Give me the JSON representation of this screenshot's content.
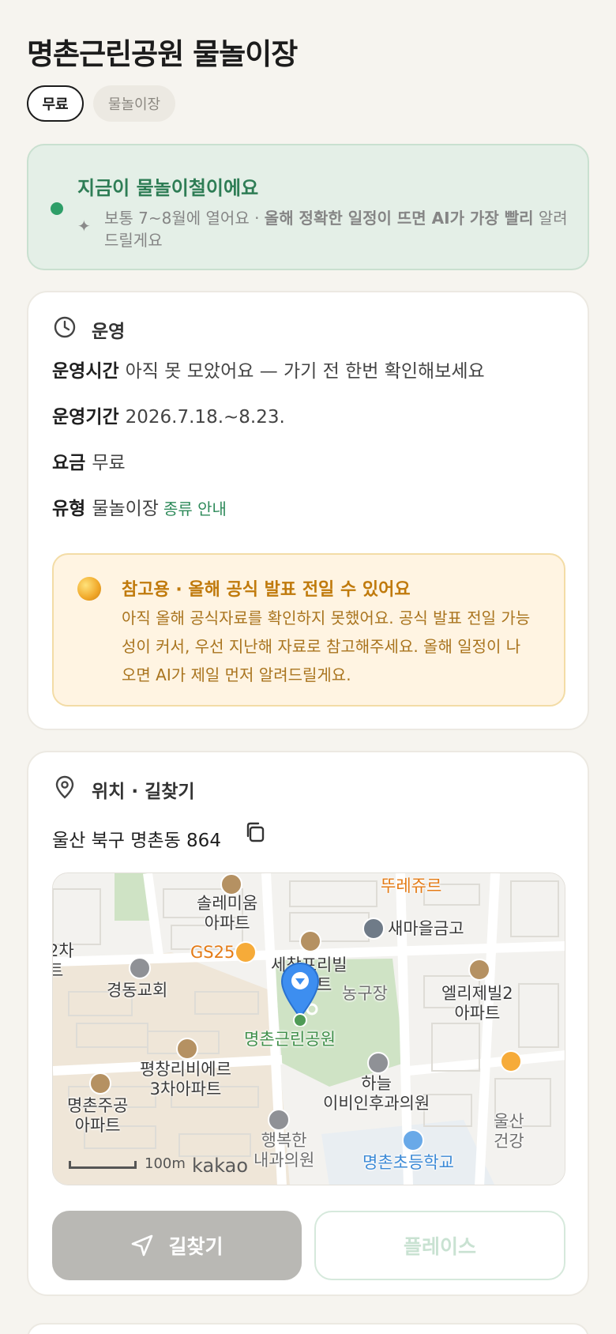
{
  "header": {
    "title": "명촌근린공원 물놀이장",
    "chips": {
      "free": "무료",
      "type": "물놀이장"
    }
  },
  "season": {
    "title": "지금이 물놀이철이에요",
    "spark_icon": "✦",
    "text_normal": "보통 7~8월에 열어요 · ",
    "text_bold": "올해 정확한 일정이 뜨면 AI가 가장 빨리",
    "text_tail": " 알려드릴게요"
  },
  "operation": {
    "section_title": "운영",
    "rows": [
      {
        "key": "운영시간",
        "value": "아직 못 모았어요 — 가기 전 한번 확인해보세요"
      },
      {
        "key": "운영기간",
        "value": "2026.7.18.~8.23."
      },
      {
        "key": "요금",
        "value": "무료"
      },
      {
        "key": "유형",
        "value": "물놀이장",
        "link": "종류 안내"
      }
    ],
    "notice": {
      "title": "참고용 · 올해 공식 발표 전일 수 있어요",
      "body": "아직 올해 공식자료를 확인하지 못했어요. 공식 발표 전일 가능성이 커서, 우선 지난해 자료로 참고해주세요. 올해 일정이 나오면 AI가 제일 먼저 알려드릴게요."
    }
  },
  "location": {
    "section_title": "위치 · 길찾기",
    "address": "울산 북구 명촌동 864",
    "map": {
      "labels": {
        "l1": "뚜레쥬르",
        "l2": "솔레미움\n아파트",
        "l3": "새마을금고",
        "l4": "2차\n트",
        "l5": "GS25",
        "l6": "세창프리빌\n아파트",
        "l7": "경동교회",
        "l8": "농구장",
        "l9": "엘리제빌2\n아파트",
        "l10": "명촌근린공원",
        "l11": "평창리비에르\n3차아파트",
        "l12": "하늘\n이비인후과의원",
        "l13": "명촌주공\n아파트",
        "l14": "울산\n건강",
        "l15": "행복한\n내과의원",
        "l16": "명촌초등학교"
      },
      "scale": "100m",
      "brand": "kakao"
    },
    "buttons": {
      "route": "길찾기",
      "place": "플레이스"
    }
  },
  "colors": {
    "accent_green": "#2e8a5a",
    "warning": "#c07a0c",
    "pin": "#3d8ef0"
  }
}
